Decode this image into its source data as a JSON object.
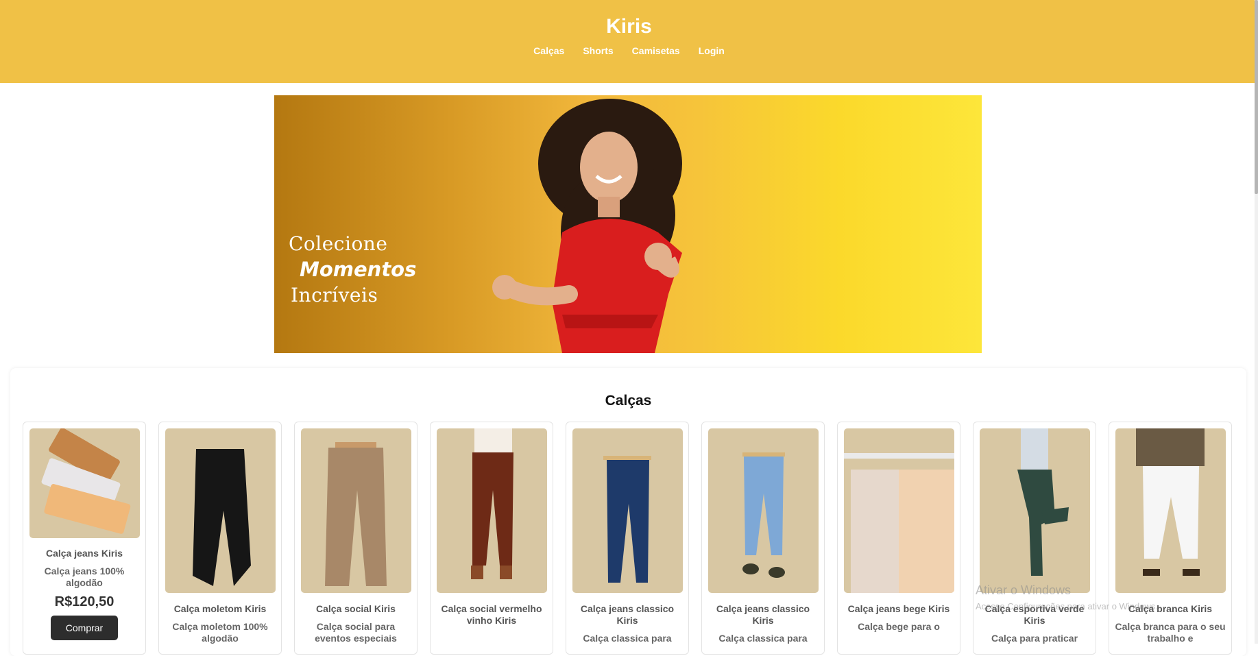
{
  "header": {
    "brand": "Kiris",
    "nav": [
      "Calças",
      "Shorts",
      "Camisetas",
      "Login"
    ]
  },
  "hero": {
    "line1": "Colecione",
    "line2": "Momentos",
    "line3": "Incríveis"
  },
  "section": {
    "title": "Calças",
    "products": [
      {
        "name": "Calça jeans Kiris",
        "desc": "Calça jeans 100% algodão",
        "price": "R$120,50",
        "button": "Comprar"
      },
      {
        "name": "Calça moletom Kiris",
        "desc": "Calça moletom 100% algodão"
      },
      {
        "name": "Calça social Kiris",
        "desc": "Calça social para eventos especiais"
      },
      {
        "name": "Calça social vermelho vinho Kiris",
        "desc": ""
      },
      {
        "name": "Calça jeans classico Kiris",
        "desc": "Calça classica para"
      },
      {
        "name": "Calça jeans classico Kiris",
        "desc": "Calça classica para"
      },
      {
        "name": "Calça jeans bege Kiris",
        "desc": "Calça bege para o"
      },
      {
        "name": "Calça esportiva verde Kiris",
        "desc": "Calça para praticar"
      },
      {
        "name": "Calça branca Kiris",
        "desc": "Calça branca para o seu trabalho e"
      }
    ]
  },
  "watermark": {
    "line1": "Ativar o Windows",
    "line2": "Acesse Configurações para ativar o Windows."
  },
  "colors": {
    "header": "#f0c146",
    "card_image_bg": "#d8c7a3",
    "button": "#2d2d2d"
  }
}
